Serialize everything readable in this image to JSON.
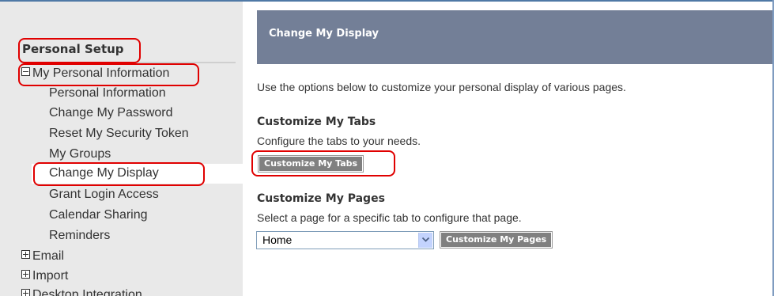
{
  "sidebar": {
    "header": "Personal Setup",
    "items": [
      {
        "label": "My Personal Information",
        "type": "parent",
        "expanded": true
      },
      {
        "label": "Personal Information",
        "type": "child"
      },
      {
        "label": "Change My Password",
        "type": "child"
      },
      {
        "label": "Reset My Security Token",
        "type": "child"
      },
      {
        "label": "My Groups",
        "type": "child"
      },
      {
        "label": "Change My Display",
        "type": "child",
        "selected": true
      },
      {
        "label": "Grant Login Access",
        "type": "child"
      },
      {
        "label": "Calendar Sharing",
        "type": "child"
      },
      {
        "label": "Reminders",
        "type": "child"
      },
      {
        "label": "Email",
        "type": "parent",
        "expanded": false
      },
      {
        "label": "Import",
        "type": "parent",
        "expanded": false
      },
      {
        "label": "Desktop Integration",
        "type": "parent",
        "expanded": false
      }
    ]
  },
  "main": {
    "title": "Change My Display",
    "intro": "Use the options below to customize your personal display of various pages.",
    "tabs_section": {
      "title": "Customize My Tabs",
      "description": "Configure the tabs to your needs.",
      "button_label": "Customize My Tabs"
    },
    "pages_section": {
      "title": "Customize My Pages",
      "description": "Select a page for a specific tab to configure that page.",
      "select_value": "Home",
      "button_label": "Customize My Pages"
    }
  },
  "colors": {
    "header_bg": "#737f97",
    "sidebar_bg": "#e9e9e9",
    "button_bg": "#808080",
    "annotation": "#e00000"
  }
}
